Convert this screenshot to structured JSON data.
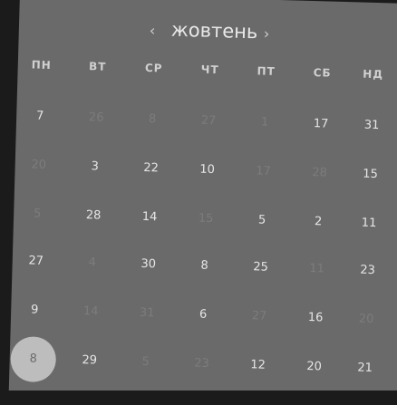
{
  "calendar": {
    "month": "жовтень",
    "prev_icon": "chevron-left-icon",
    "next_icon": "chevron-right-icon",
    "prev_glyph": "‹",
    "next_glyph": "›",
    "weekdays": [
      "ПН",
      "ВТ",
      "СР",
      "ЧТ",
      "ПТ",
      "СБ",
      "НД"
    ],
    "weeks": [
      [
        {
          "t": "7"
        },
        {
          "t": "26",
          "m": true
        },
        {
          "t": "8",
          "m": true
        },
        {
          "t": "27",
          "m": true
        },
        {
          "t": "1",
          "m": true
        },
        {
          "t": "17"
        },
        {
          "t": "31"
        }
      ],
      [
        {
          "t": "20",
          "m": true
        },
        {
          "t": "3"
        },
        {
          "t": "22"
        },
        {
          "t": "10"
        },
        {
          "t": "17",
          "m": true
        },
        {
          "t": "28",
          "m": true
        },
        {
          "t": "15"
        }
      ],
      [
        {
          "t": "5",
          "m": true
        },
        {
          "t": "28"
        },
        {
          "t": "14"
        },
        {
          "t": "15",
          "m": true
        },
        {
          "t": "5"
        },
        {
          "t": "2"
        },
        {
          "t": "11"
        }
      ],
      [
        {
          "t": "27"
        },
        {
          "t": "4",
          "m": true
        },
        {
          "t": "30"
        },
        {
          "t": "8"
        },
        {
          "t": "25"
        },
        {
          "t": "11",
          "m": true
        },
        {
          "t": "23"
        }
      ],
      [
        {
          "t": "9"
        },
        {
          "t": "14",
          "m": true
        },
        {
          "t": "31",
          "m": true
        },
        {
          "t": "6"
        },
        {
          "t": "27",
          "m": true
        },
        {
          "t": "16"
        },
        {
          "t": "20",
          "m": true
        }
      ],
      [
        {
          "t": "8",
          "s": true
        },
        {
          "t": "29"
        },
        {
          "t": "5",
          "m": true
        },
        {
          "t": "23",
          "m": true
        },
        {
          "t": "12"
        },
        {
          "t": "20"
        },
        {
          "t": "21"
        }
      ]
    ],
    "colors": {
      "panel": "#6a6a6a",
      "background": "#1b1b1b",
      "selected": "#bdbdbd",
      "muted_text": "#7c7c7c",
      "text": "#e6e6e6"
    }
  }
}
